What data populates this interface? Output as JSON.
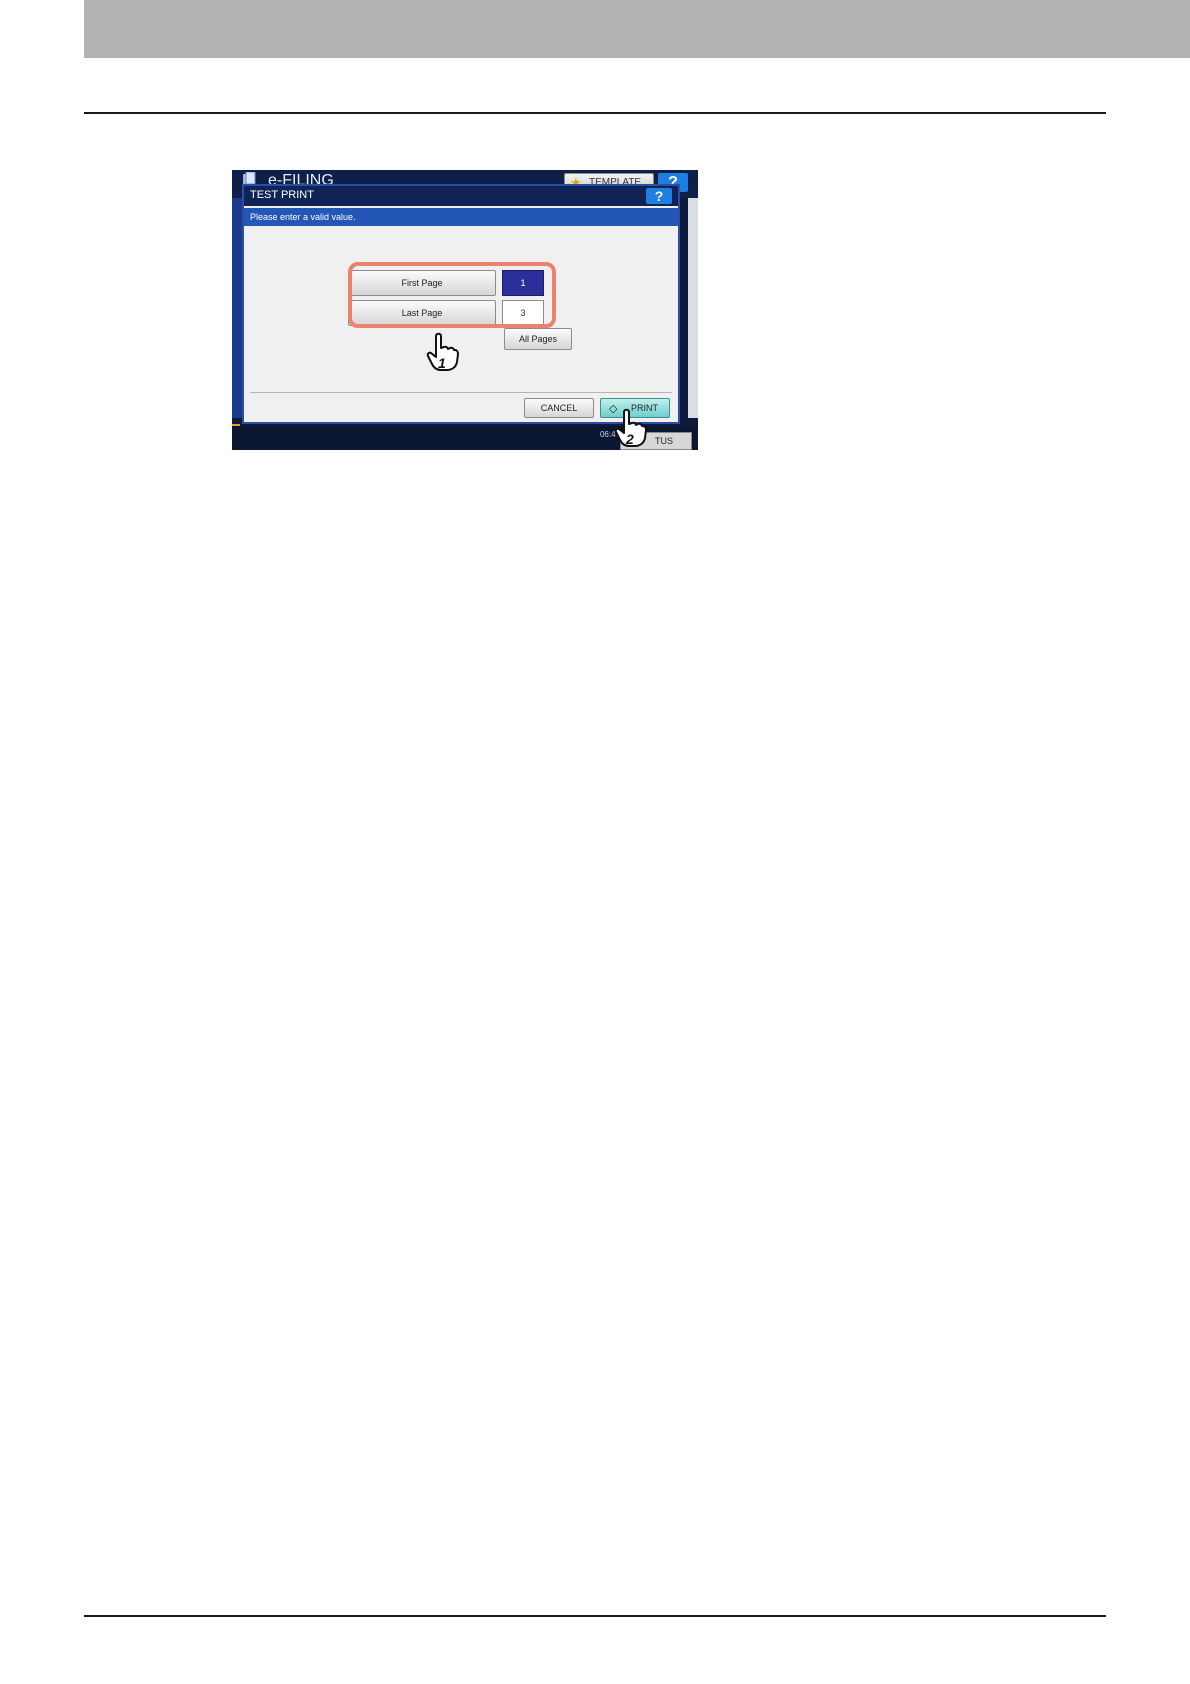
{
  "app": {
    "title": "e-FILING",
    "template_label": "TEMPLATE",
    "help_label": "?",
    "clock": "06:47",
    "status_label": "TUS"
  },
  "dialog": {
    "title": "TEST PRINT",
    "help_label": "?",
    "message": "Please enter a valid value.",
    "first_page_label": "First Page",
    "first_page_value": "1",
    "last_page_label": "Last Page",
    "last_page_value": "3",
    "all_pages_label": "All Pages",
    "cancel_label": "CANCEL",
    "print_label": "PRINT"
  },
  "steps": {
    "step1": "1",
    "step2": "2"
  },
  "colors": {
    "highlight": "#e9826f",
    "selected_value": "#2b2f9a",
    "print_button": "#6fcfcc"
  }
}
